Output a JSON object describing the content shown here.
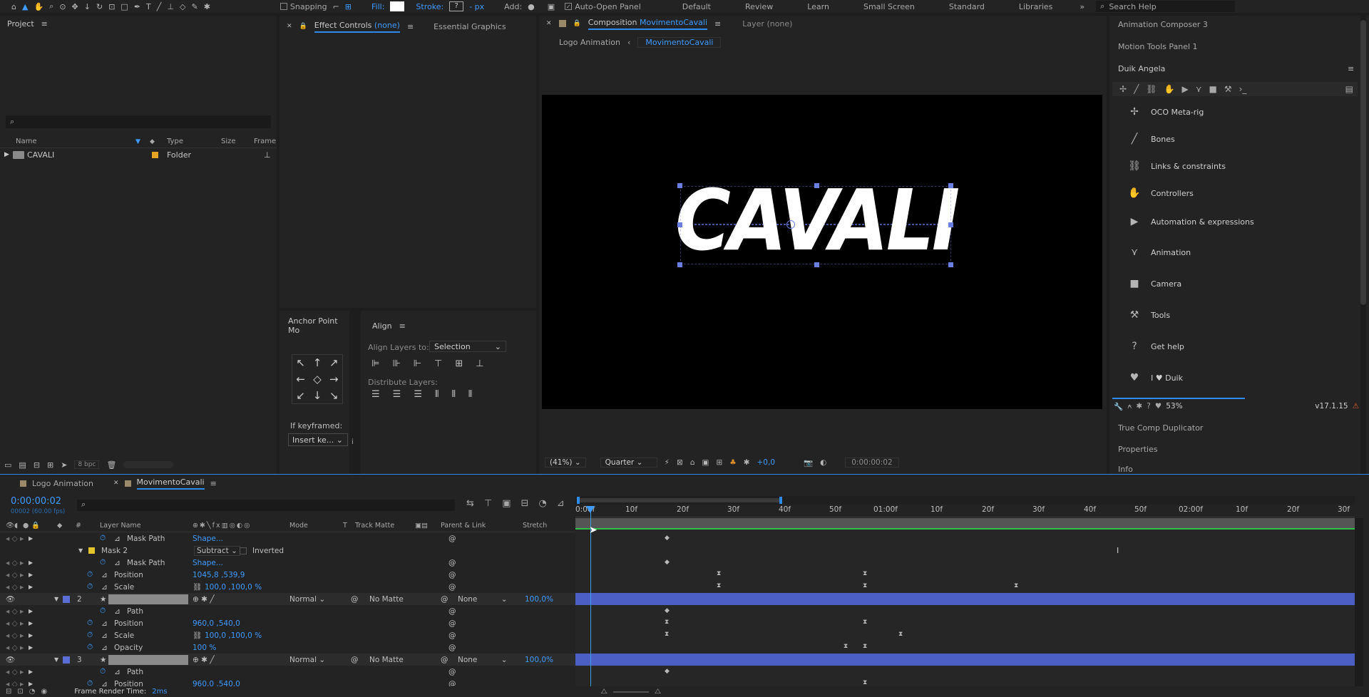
{
  "toolbar": {
    "snapping": "Snapping",
    "fill": "Fill:",
    "stroke": "Stroke:",
    "stroke_val": "?",
    "px": "- px",
    "add": "Add:",
    "auto_open": "Auto-Open Panel",
    "workspaces": [
      "Default",
      "Review",
      "Learn",
      "Small Screen",
      "Standard",
      "Libraries"
    ],
    "search_help": "Search Help"
  },
  "project": {
    "title": "Project",
    "cols": [
      "Name",
      "Type",
      "Size",
      "Frame"
    ],
    "rows": [
      {
        "name": "CAVALI",
        "type": "Folder"
      }
    ],
    "bpc": "8 bpc"
  },
  "effects": {
    "tab": "Effect Controls",
    "tab_val": "(none)",
    "tab2": "Essential Graphics"
  },
  "anchor": {
    "title": "Anchor Point Mo",
    "if_keyframed": "If keyframed:",
    "select": "Insert ke..."
  },
  "align": {
    "title": "Align",
    "layers_to": "Align Layers to:",
    "selection": "Selection",
    "distribute": "Distribute Layers:"
  },
  "comp": {
    "tab_label": "Composition",
    "tab_name": "MovimentoCavali",
    "layer_label": "Layer",
    "layer_val": "(none)",
    "breadcrumb": [
      "Logo Animation",
      "MovimentoCavali"
    ],
    "logo_text": "CAVALI",
    "zoom": "(41%)",
    "resolution": "Quarter",
    "exposure": "+0,0",
    "timecode": "0:00:00:02"
  },
  "right": {
    "panels": [
      "Animation Composer 3",
      "Motion Tools Panel 1"
    ],
    "duik_title": "Duik Angela",
    "duik_items": [
      "OCO Meta-rig",
      "Bones",
      "Links & constraints",
      "Controllers",
      "Automation & expressions",
      "Animation",
      "Camera",
      "Tools",
      "Get help",
      "I ♥ Duik"
    ],
    "duik_icons": [
      "rig-icon",
      "bone-icon",
      "link-icon",
      "hand-icon",
      "play-icon",
      "animation-icon",
      "camera-icon",
      "tools-icon",
      "help-icon",
      "heart-icon"
    ],
    "percent": "53%",
    "version": "v17.1.15",
    "panels_bottom": [
      "True Comp Duplicator",
      "Properties",
      "Info"
    ]
  },
  "timeline": {
    "tabs": [
      "Logo Animation",
      "MovimentoCavali"
    ],
    "timecode": "0:00:00:02",
    "fps": "00002 (60.00 fps)",
    "cols": [
      "#",
      "Layer Name",
      "Mode",
      "T",
      "Track Matte",
      "Parent & Link",
      "Stretch"
    ],
    "ruler": [
      "0:00f",
      "10f",
      "20f",
      "30f",
      "40f",
      "50f",
      "01:00f",
      "10f",
      "20f",
      "30f",
      "40f",
      "50f",
      "02:00f",
      "10f",
      "20f",
      "30f"
    ],
    "rows": [
      {
        "indent": 1,
        "name": "Mask Path",
        "value": "Shape..."
      },
      {
        "indent": 0,
        "name": "Mask 2",
        "mode": "Subtract",
        "inverted": "Inverted"
      },
      {
        "indent": 1,
        "name": "Mask Path",
        "value": "Shape..."
      },
      {
        "indent": 1,
        "name": "Position",
        "value": "1045,8 ,539,9"
      },
      {
        "indent": 1,
        "name": "Scale",
        "value": "100,0 ,100,0 %"
      },
      {
        "layer": "2",
        "name": "",
        "mode": "Normal",
        "matte": "No Matte",
        "parent": "None",
        "stretch": "100,0%"
      },
      {
        "indent": 1,
        "name": "Path"
      },
      {
        "indent": 1,
        "name": "Position",
        "value": "960,0 ,540,0"
      },
      {
        "indent": 1,
        "name": "Scale",
        "value": "100,0 ,100,0 %"
      },
      {
        "indent": 1,
        "name": "Opacity",
        "value": "100 %"
      },
      {
        "layer": "3",
        "name": "",
        "mode": "Normal",
        "matte": "No Matte",
        "parent": "None",
        "stretch": "100,0%"
      },
      {
        "indent": 1,
        "name": "Path"
      },
      {
        "indent": 1,
        "name": "Position",
        "value": "960,0 ,540,0"
      }
    ],
    "frame_render": "Frame Render Time:",
    "frame_render_val": "2ms"
  }
}
